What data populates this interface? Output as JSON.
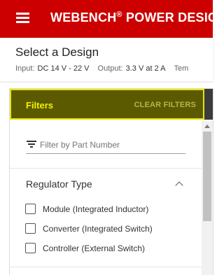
{
  "header": {
    "title": "WEBENCH",
    "title_mark": "®",
    "title_rest": "POWER DESIGNE",
    "background": "#cc0000",
    "menu_icon": "hamburger-menu-icon"
  },
  "subheader": {
    "page_title": "Select a Design",
    "specs": [
      {
        "label": "Input:",
        "value": "DC 14 V - 22 V"
      },
      {
        "label": "Output:",
        "value": "3.3 V at 2 A"
      },
      {
        "label": "Tem",
        "value": ""
      }
    ]
  },
  "filters": {
    "title": "Filters",
    "clear_label": "CLEAR FILTERS",
    "search": {
      "placeholder": "Filter by Part Number",
      "value": "",
      "icon": "filter-icon"
    },
    "sections": [
      {
        "title": "Regulator Type",
        "expanded": true,
        "options": [
          {
            "label": "Module (Integrated Inductor)",
            "checked": false
          },
          {
            "label": "Converter (Integrated Switch)",
            "checked": false
          },
          {
            "label": "Controller (External Switch)",
            "checked": false
          }
        ]
      }
    ],
    "colors": {
      "header_bg": "#5c5a00",
      "header_border": "#e6e600",
      "title": "#f2f200"
    }
  }
}
